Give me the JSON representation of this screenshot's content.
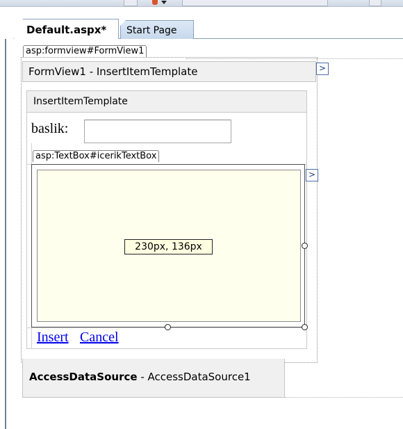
{
  "tabs": [
    {
      "label": "Default.aspx*",
      "active": true
    },
    {
      "label": "Start Page",
      "active": false
    }
  ],
  "formview": {
    "tag": "asp:formview#FormView1",
    "header": "FormView1 - InsertItemTemplate",
    "smart_tag_glyph": ">",
    "template_header": "InsertItemTemplate",
    "field_label": "baslik:",
    "field_value": "",
    "textbox_tag": "asp:TextBox#icerikTextBox",
    "textbox_smart_tag_glyph": ">",
    "resize_tooltip": "230px, 136px",
    "insert_link": "Insert",
    "cancel_link": "Cancel"
  },
  "datasource": {
    "type": "AccessDataSource",
    "separator": " - ",
    "id": "AccessDataSource1"
  },
  "colors": {
    "textbox_fill": "#ffffee",
    "link": "#0000ee",
    "tab_inactive": "#c7d8ec",
    "tooltip_fill": "#ffffe1"
  }
}
